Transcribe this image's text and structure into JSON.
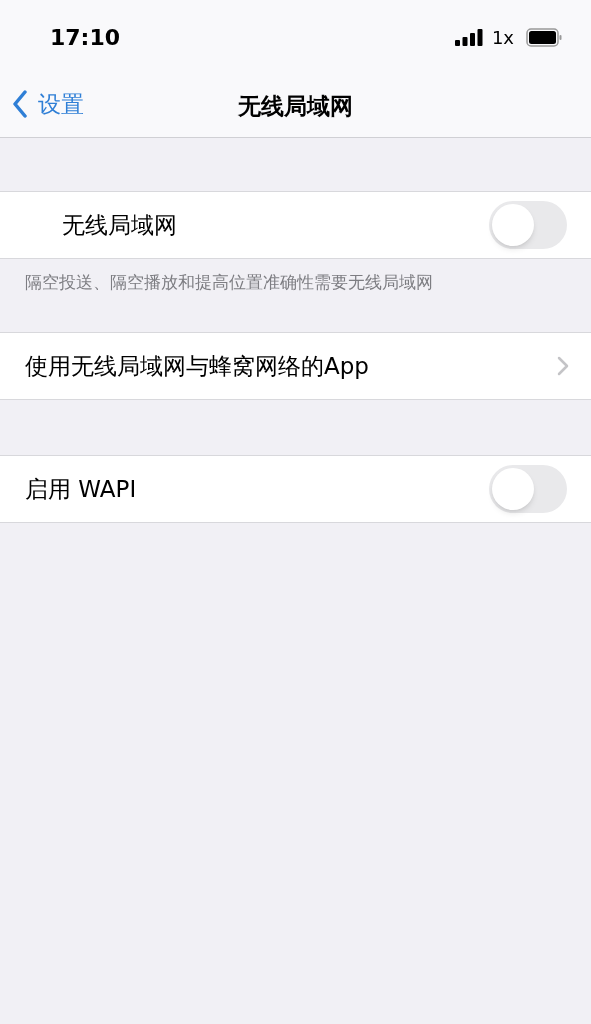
{
  "status_bar": {
    "time": "17:10",
    "network": "1x"
  },
  "nav": {
    "back": "设置",
    "title": "无线局域网"
  },
  "sections": [
    {
      "rows": [
        {
          "kind": "toggle",
          "label": "无线局域网",
          "on": false
        }
      ],
      "footer": "隔空投送、隔空播放和提高位置准确性需要无线局域网"
    },
    {
      "rows": [
        {
          "kind": "link",
          "label": "使用无线局域网与蜂窝网络的App"
        }
      ]
    },
    {
      "rows": [
        {
          "kind": "toggle",
          "label": "启用 WAPI",
          "on": false
        }
      ]
    }
  ]
}
